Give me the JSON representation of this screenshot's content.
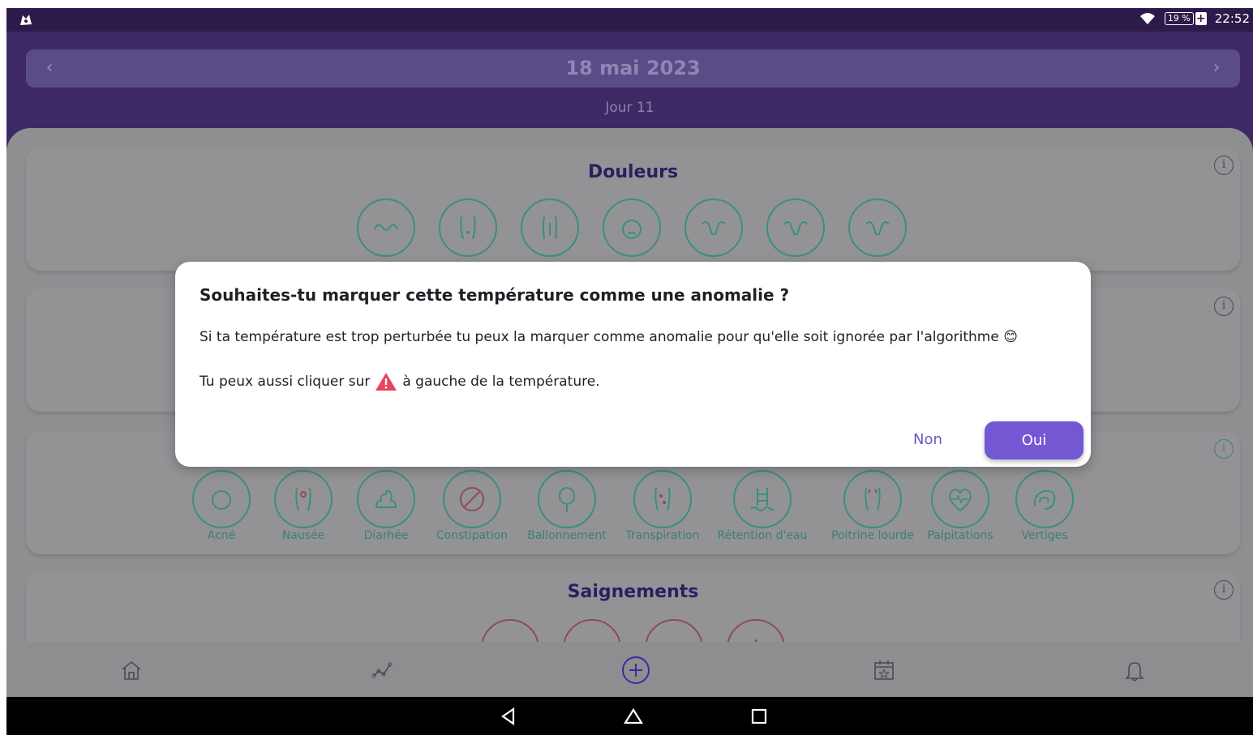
{
  "status_bar": {
    "battery_percent": "19 %",
    "time": "22:52"
  },
  "header": {
    "date": "18 mai 2023",
    "day": "Jour 11"
  },
  "sections": {
    "douleurs": {
      "title": "Douleurs"
    },
    "symptomes": {
      "items": [
        "Acné",
        "Nausée",
        "Diarhée",
        "Constipation",
        "Ballonnement",
        "Transpiration",
        "Rétention d'eau",
        "Poitrine lourde",
        "Palpitations",
        "Vertiges"
      ]
    },
    "saignements": {
      "title": "Saignements"
    }
  },
  "dialog": {
    "title": "Souhaites-tu marquer cette température comme une anomalie ?",
    "body1": "Si ta température est trop perturbée tu peux la marquer comme anomalie pour qu'elle soit ignorée par l'algorithme",
    "body1_emoji": "😊",
    "body2_prefix": "Tu peux aussi cliquer sur",
    "body2_suffix": "à gauche de la température.",
    "no_label": "Non",
    "yes_label": "Oui"
  },
  "colors": {
    "accent": "#7457d3",
    "header_bg": "#3d2a65",
    "warning": "#e8445f",
    "symptom_teal": "#3c8f7a",
    "bleeding_pink": "#8e4b5a"
  },
  "icons": {
    "nav": [
      "home-icon",
      "chart-icon",
      "add-icon",
      "calendar-icon",
      "bell-icon"
    ],
    "system": [
      "back-icon",
      "home-icon",
      "recents-icon"
    ]
  }
}
